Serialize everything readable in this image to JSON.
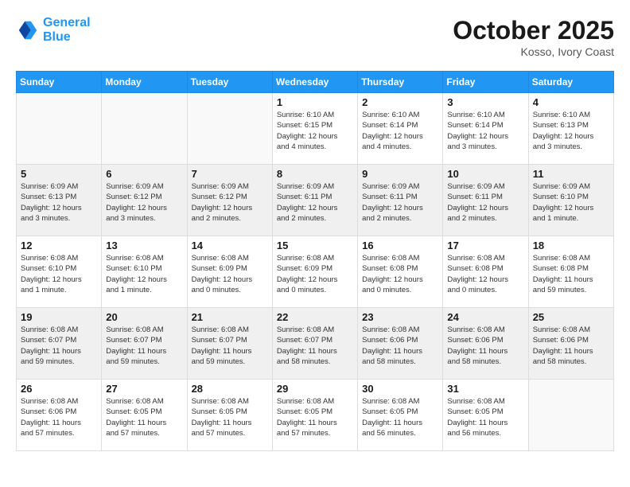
{
  "header": {
    "logo": {
      "line1": "General",
      "line2": "Blue"
    },
    "month": "October 2025",
    "location": "Kosso, Ivory Coast"
  },
  "weekdays": [
    "Sunday",
    "Monday",
    "Tuesday",
    "Wednesday",
    "Thursday",
    "Friday",
    "Saturday"
  ],
  "weeks": [
    [
      {
        "day": "",
        "info": ""
      },
      {
        "day": "",
        "info": ""
      },
      {
        "day": "",
        "info": ""
      },
      {
        "day": "1",
        "info": "Sunrise: 6:10 AM\nSunset: 6:15 PM\nDaylight: 12 hours\nand 4 minutes."
      },
      {
        "day": "2",
        "info": "Sunrise: 6:10 AM\nSunset: 6:14 PM\nDaylight: 12 hours\nand 4 minutes."
      },
      {
        "day": "3",
        "info": "Sunrise: 6:10 AM\nSunset: 6:14 PM\nDaylight: 12 hours\nand 3 minutes."
      },
      {
        "day": "4",
        "info": "Sunrise: 6:10 AM\nSunset: 6:13 PM\nDaylight: 12 hours\nand 3 minutes."
      }
    ],
    [
      {
        "day": "5",
        "info": "Sunrise: 6:09 AM\nSunset: 6:13 PM\nDaylight: 12 hours\nand 3 minutes."
      },
      {
        "day": "6",
        "info": "Sunrise: 6:09 AM\nSunset: 6:12 PM\nDaylight: 12 hours\nand 3 minutes."
      },
      {
        "day": "7",
        "info": "Sunrise: 6:09 AM\nSunset: 6:12 PM\nDaylight: 12 hours\nand 2 minutes."
      },
      {
        "day": "8",
        "info": "Sunrise: 6:09 AM\nSunset: 6:11 PM\nDaylight: 12 hours\nand 2 minutes."
      },
      {
        "day": "9",
        "info": "Sunrise: 6:09 AM\nSunset: 6:11 PM\nDaylight: 12 hours\nand 2 minutes."
      },
      {
        "day": "10",
        "info": "Sunrise: 6:09 AM\nSunset: 6:11 PM\nDaylight: 12 hours\nand 2 minutes."
      },
      {
        "day": "11",
        "info": "Sunrise: 6:09 AM\nSunset: 6:10 PM\nDaylight: 12 hours\nand 1 minute."
      }
    ],
    [
      {
        "day": "12",
        "info": "Sunrise: 6:08 AM\nSunset: 6:10 PM\nDaylight: 12 hours\nand 1 minute."
      },
      {
        "day": "13",
        "info": "Sunrise: 6:08 AM\nSunset: 6:10 PM\nDaylight: 12 hours\nand 1 minute."
      },
      {
        "day": "14",
        "info": "Sunrise: 6:08 AM\nSunset: 6:09 PM\nDaylight: 12 hours\nand 0 minutes."
      },
      {
        "day": "15",
        "info": "Sunrise: 6:08 AM\nSunset: 6:09 PM\nDaylight: 12 hours\nand 0 minutes."
      },
      {
        "day": "16",
        "info": "Sunrise: 6:08 AM\nSunset: 6:08 PM\nDaylight: 12 hours\nand 0 minutes."
      },
      {
        "day": "17",
        "info": "Sunrise: 6:08 AM\nSunset: 6:08 PM\nDaylight: 12 hours\nand 0 minutes."
      },
      {
        "day": "18",
        "info": "Sunrise: 6:08 AM\nSunset: 6:08 PM\nDaylight: 11 hours\nand 59 minutes."
      }
    ],
    [
      {
        "day": "19",
        "info": "Sunrise: 6:08 AM\nSunset: 6:07 PM\nDaylight: 11 hours\nand 59 minutes."
      },
      {
        "day": "20",
        "info": "Sunrise: 6:08 AM\nSunset: 6:07 PM\nDaylight: 11 hours\nand 59 minutes."
      },
      {
        "day": "21",
        "info": "Sunrise: 6:08 AM\nSunset: 6:07 PM\nDaylight: 11 hours\nand 59 minutes."
      },
      {
        "day": "22",
        "info": "Sunrise: 6:08 AM\nSunset: 6:07 PM\nDaylight: 11 hours\nand 58 minutes."
      },
      {
        "day": "23",
        "info": "Sunrise: 6:08 AM\nSunset: 6:06 PM\nDaylight: 11 hours\nand 58 minutes."
      },
      {
        "day": "24",
        "info": "Sunrise: 6:08 AM\nSunset: 6:06 PM\nDaylight: 11 hours\nand 58 minutes."
      },
      {
        "day": "25",
        "info": "Sunrise: 6:08 AM\nSunset: 6:06 PM\nDaylight: 11 hours\nand 58 minutes."
      }
    ],
    [
      {
        "day": "26",
        "info": "Sunrise: 6:08 AM\nSunset: 6:06 PM\nDaylight: 11 hours\nand 57 minutes."
      },
      {
        "day": "27",
        "info": "Sunrise: 6:08 AM\nSunset: 6:05 PM\nDaylight: 11 hours\nand 57 minutes."
      },
      {
        "day": "28",
        "info": "Sunrise: 6:08 AM\nSunset: 6:05 PM\nDaylight: 11 hours\nand 57 minutes."
      },
      {
        "day": "29",
        "info": "Sunrise: 6:08 AM\nSunset: 6:05 PM\nDaylight: 11 hours\nand 57 minutes."
      },
      {
        "day": "30",
        "info": "Sunrise: 6:08 AM\nSunset: 6:05 PM\nDaylight: 11 hours\nand 56 minutes."
      },
      {
        "day": "31",
        "info": "Sunrise: 6:08 AM\nSunset: 6:05 PM\nDaylight: 11 hours\nand 56 minutes."
      },
      {
        "day": "",
        "info": ""
      }
    ]
  ]
}
